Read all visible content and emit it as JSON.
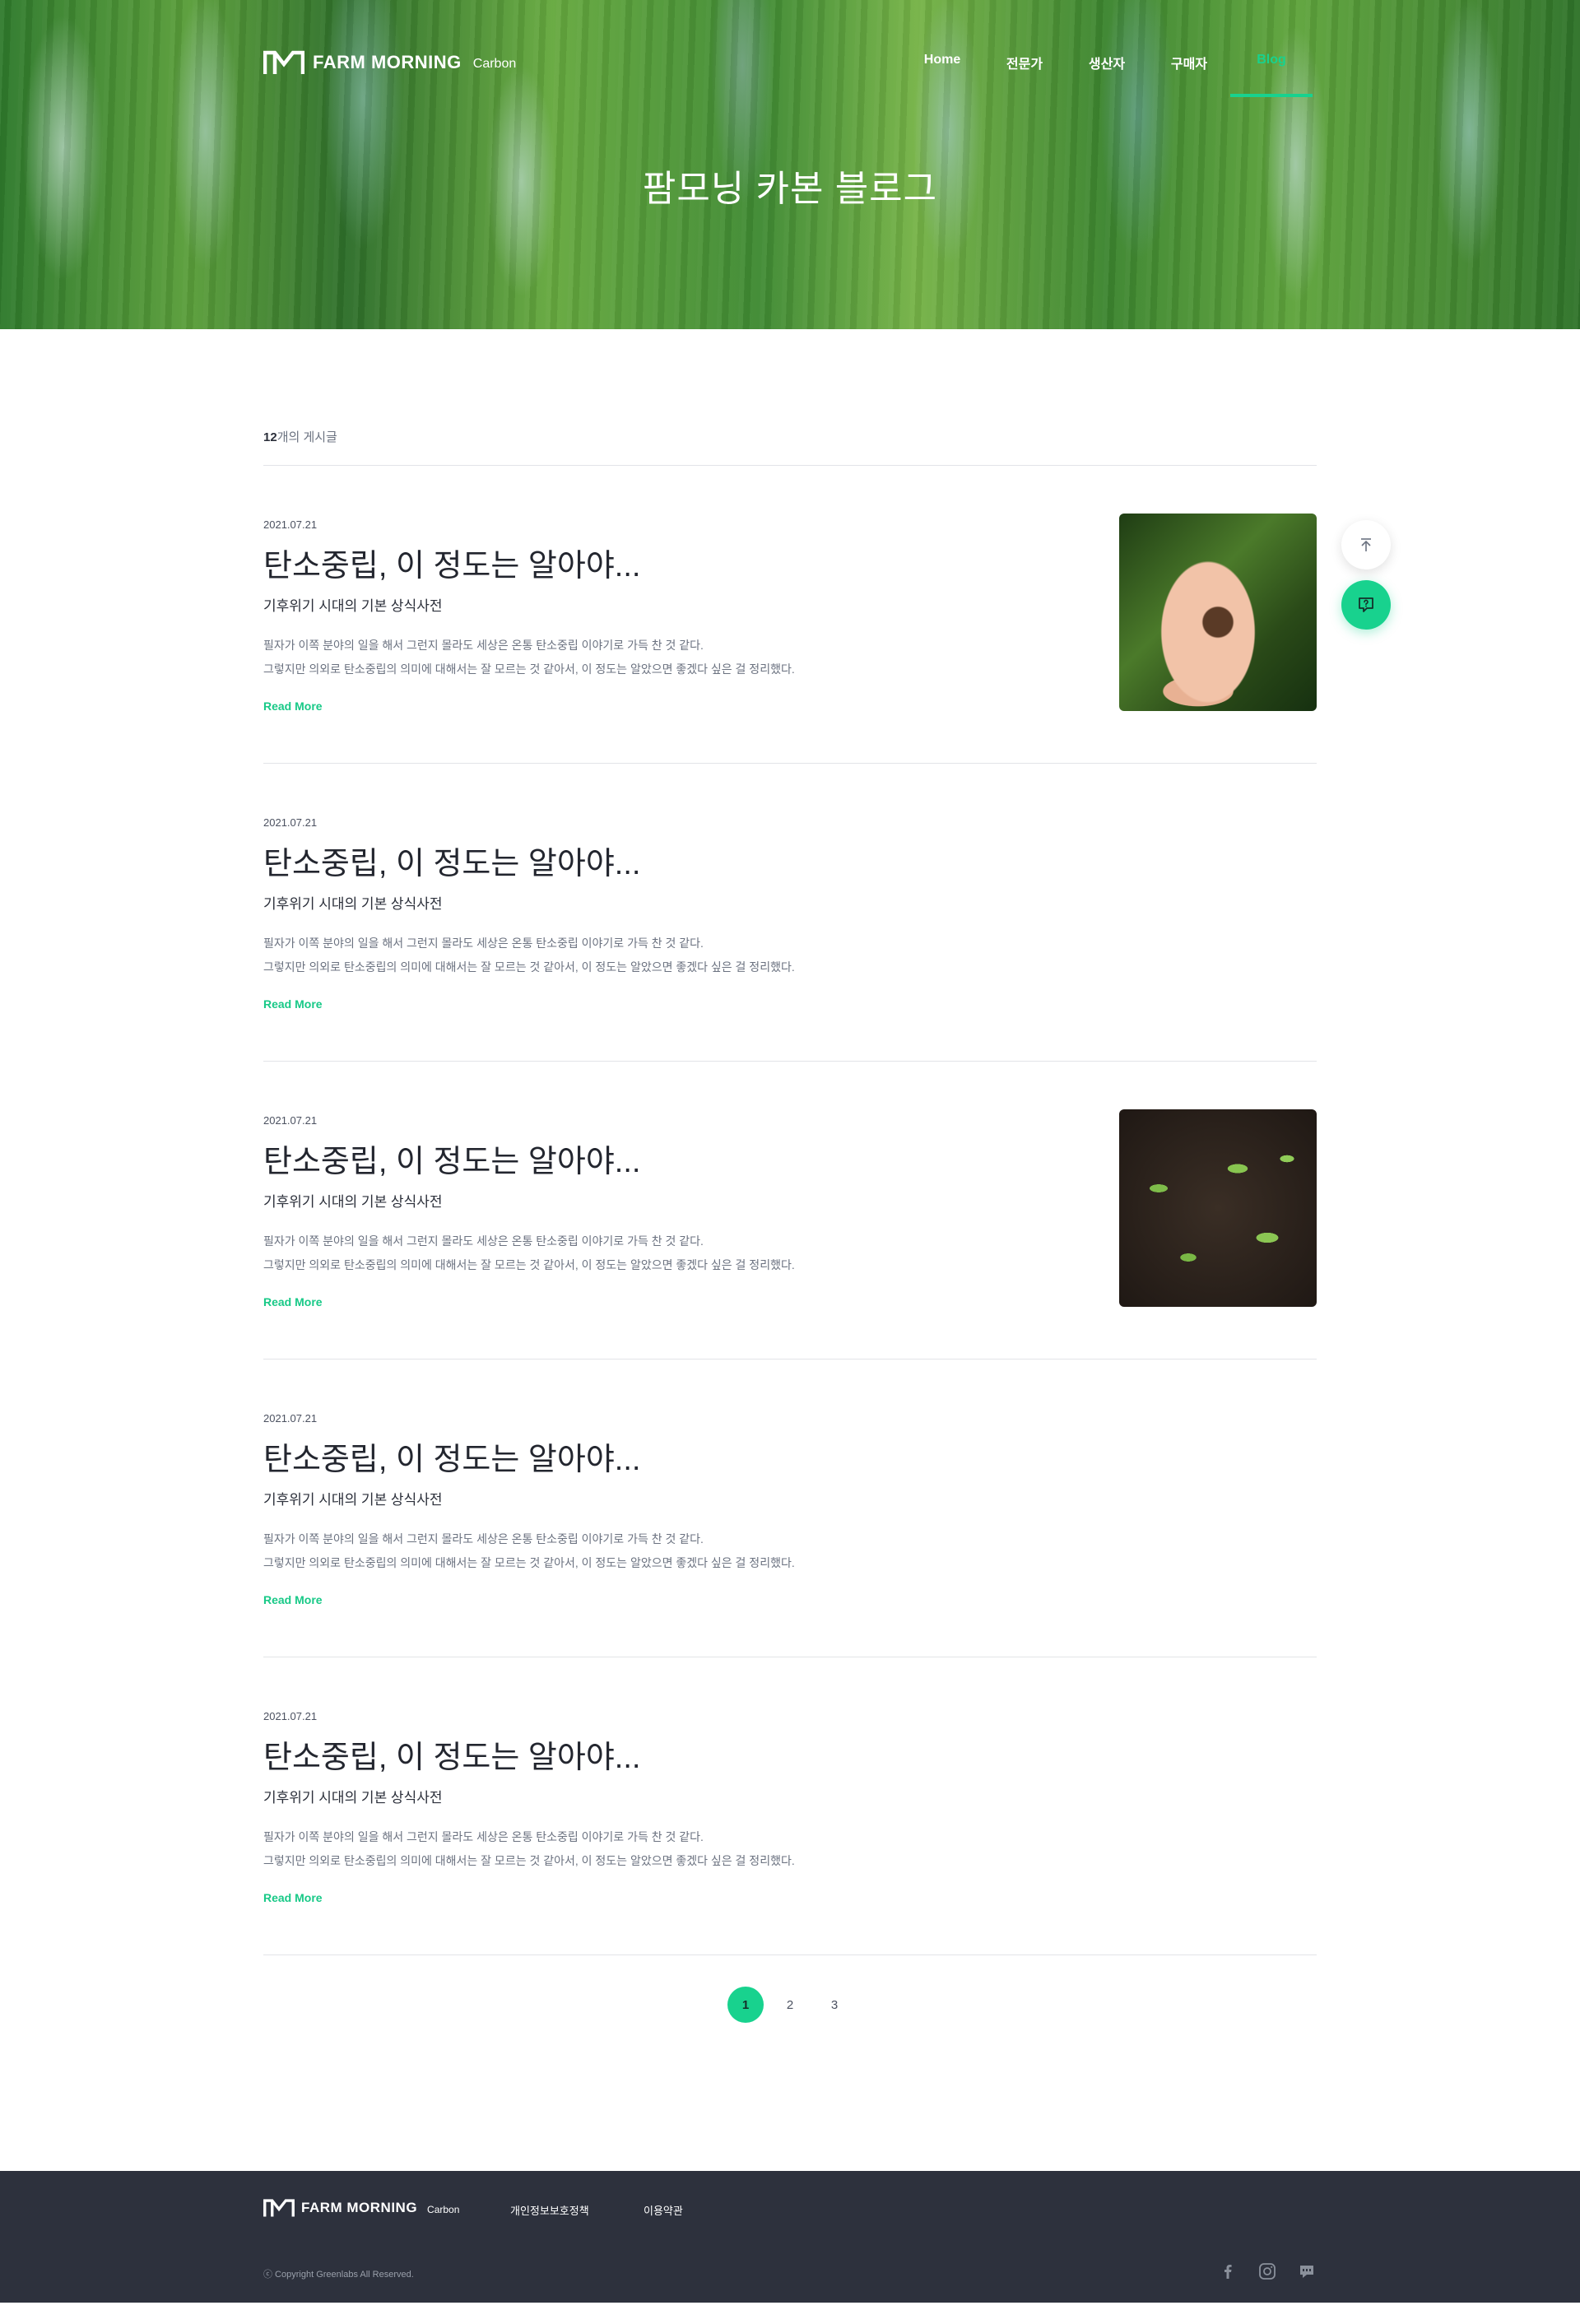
{
  "header": {
    "brand": "FARM MORNING",
    "brand_sub": "Carbon",
    "nav": [
      {
        "label": "Home"
      },
      {
        "label": "전문가"
      },
      {
        "label": "생산자"
      },
      {
        "label": "구매자"
      },
      {
        "label": "Blog"
      }
    ],
    "active_nav": "Blog",
    "hero_title": "팜모닝 카본 블로그"
  },
  "listing": {
    "count": "12",
    "count_suffix": "개의 게시글"
  },
  "posts": [
    {
      "date": "2021.07.21",
      "title": "탄소중립, 이 정도는 알아야...",
      "subtitle": "기후위기 시대의 기본 상식사전",
      "excerpt_line1": "필자가 이쪽 분야의 일을 해서 그런지 몰라도 세상은 온통 탄소중립 이야기로 가득 찬 것 같다.",
      "excerpt_line2": "그렇지만 의외로 탄소중립의 의미에 대해서는 잘 모르는 것 같아서, 이 정도는 알았으면 좋겠다 싶은 걸 정리했다.",
      "read_more": "Read More",
      "thumbnail": "hand-sprout-image"
    },
    {
      "date": "2021.07.21",
      "title": "탄소중립, 이 정도는 알아야...",
      "subtitle": "기후위기 시대의 기본 상식사전",
      "excerpt_line1": "필자가 이쪽 분야의 일을 해서 그런지 몰라도 세상은 온통 탄소중립 이야기로 가득 찬 것 같다.",
      "excerpt_line2": "그렇지만 의외로 탄소중립의 의미에 대해서는 잘 모르는 것 같아서, 이 정도는 알았으면 좋겠다 싶은 걸 정리했다.",
      "read_more": "Read More"
    },
    {
      "date": "2021.07.21",
      "title": "탄소중립, 이 정도는 알아야...",
      "subtitle": "기후위기 시대의 기본 상식사전",
      "excerpt_line1": "필자가 이쪽 분야의 일을 해서 그런지 몰라도 세상은 온통 탄소중립 이야기로 가득 찬 것 같다.",
      "excerpt_line2": "그렇지만 의외로 탄소중립의 의미에 대해서는 잘 모르는 것 같아서, 이 정도는 알았으면 좋겠다 싶은 걸 정리했다.",
      "read_more": "Read More",
      "thumbnail": "soil-seedlings-image"
    },
    {
      "date": "2021.07.21",
      "title": "탄소중립, 이 정도는 알아야...",
      "subtitle": "기후위기 시대의 기본 상식사전",
      "excerpt_line1": "필자가 이쪽 분야의 일을 해서 그런지 몰라도 세상은 온통 탄소중립 이야기로 가득 찬 것 같다.",
      "excerpt_line2": "그렇지만 의외로 탄소중립의 의미에 대해서는 잘 모르는 것 같아서, 이 정도는 알았으면 좋겠다 싶은 걸 정리했다.",
      "read_more": "Read More"
    },
    {
      "date": "2021.07.21",
      "title": "탄소중립, 이 정도는 알아야...",
      "subtitle": "기후위기 시대의 기본 상식사전",
      "excerpt_line1": "필자가 이쪽 분야의 일을 해서 그런지 몰라도 세상은 온통 탄소중립 이야기로 가득 찬 것 같다.",
      "excerpt_line2": "그렇지만 의외로 탄소중립의 의미에 대해서는 잘 모르는 것 같아서, 이 정도는 알았으면 좋겠다 싶은 걸 정리했다.",
      "read_more": "Read More"
    }
  ],
  "pagination": {
    "pages": [
      "1",
      "2",
      "3"
    ],
    "current": "1"
  },
  "floating": {
    "top_icon": "arrow-to-top-icon",
    "chat_icon": "chat-help-icon"
  },
  "footer": {
    "brand": "FARM MORNING",
    "brand_sub": "Carbon",
    "privacy": "개인정보보호정책",
    "terms": "이용약관",
    "copyright": "ⓒ Copyright Greenlabs All Reserved.",
    "socials": [
      "facebook-icon",
      "instagram-icon",
      "kakao-chat-icon"
    ]
  },
  "colors": {
    "accent": "#18d28e",
    "footer_bg": "#2d313d",
    "text_dark": "#23262f",
    "text_muted": "#6b7280"
  }
}
